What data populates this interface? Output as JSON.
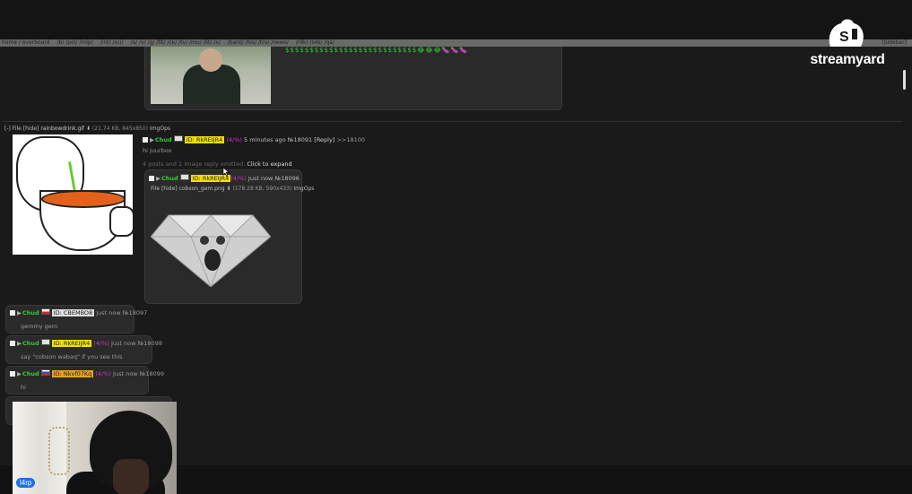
{
  "board_nav": {
    "links": [
      "home / overboard",
      "/b/ /pol/ /mlp/",
      "/int/ /sci/",
      "/a/ /v/ /g/ /fit/ /ck/ /tv/ /mu/ /lit/ /x/",
      "/bant/ /his/ /trv/ /news/",
      "/r9k/ /s4s/ /qa/"
    ],
    "settings": "[Sidebar]"
  },
  "streamyard": {
    "wordmark": "streamyard"
  },
  "op": {
    "emoji_row": "$$$$$$$$$$$$$$$$$$$$$$$$$$$😂😂😂🍆🍆🍆"
  },
  "thread": {
    "collapse": "[-]",
    "file_label": "File",
    "file_hide": "[hide]",
    "file_name": "rainbowdrink.gif",
    "file_meta": "(21.74 KB, 845x850)",
    "file_imgops": "ImgOps",
    "post": {
      "name": "Chud",
      "id": "ID: RkREIJR4",
      "pct": "(4/%)",
      "time": "5 minutes ago",
      "no": "№18091",
      "reply": "[Reply]",
      "backlink": ">>18100",
      "message": "hi juurbox"
    },
    "omitted": "4 posts and 1 image reply omitted.",
    "expand": "Click to expand"
  },
  "inline_post": {
    "name": "Chud",
    "id": "ID: RkREIJR4",
    "pct": "(4/%)",
    "time": "Just now",
    "no": "№18096",
    "file_label": "File",
    "file_hide": "[hide]",
    "file_name": "cobson_gem.png",
    "file_meta": "(178.28 KB, 590x433)",
    "file_imgops": "ImgOps"
  },
  "replies": [
    {
      "name": "Chud",
      "id": "ID: CBEMBO8",
      "pct": "",
      "time": "Just now",
      "no": "№18097",
      "message": "gemmy gem",
      "id_bg": "#dddddd"
    },
    {
      "name": "Chud",
      "id": "ID: RkREIJR4",
      "pct": "(4/%)",
      "time": "Just now",
      "no": "№18098",
      "message": "say \"cobson wabaq\" if you see this",
      "id_bg": "#f0e000"
    },
    {
      "name": "Chud",
      "id": "ID: Nkvf07Kq",
      "pct": "(4/%)",
      "time": "Just now",
      "no": "№18099",
      "message": "hi",
      "id_bg": "#e8a020"
    }
  ],
  "camera": {
    "name_tag": "l4rp"
  },
  "colors": {
    "accent_name": "#33cc33",
    "id_yellow": "#f0e000",
    "streamyard_tag": "#1f6fe6"
  }
}
